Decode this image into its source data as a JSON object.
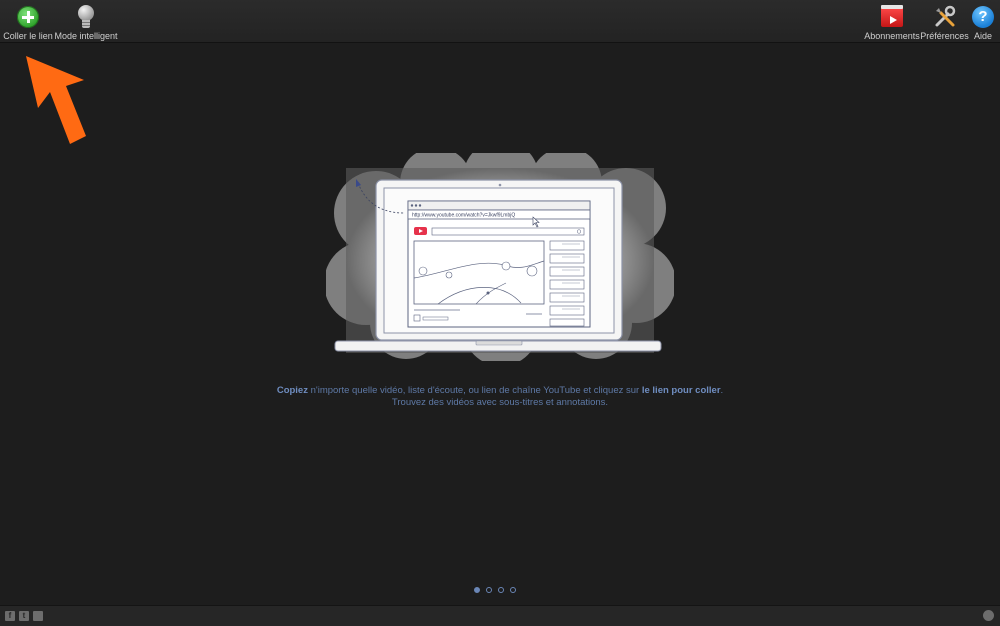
{
  "toolbar": {
    "paste_label": "Coller le lien",
    "smart_label": "Mode intelligent",
    "subs_label": "Abonnements",
    "prefs_label": "Préférences",
    "help_label": "Aide",
    "help_glyph": "?"
  },
  "illustration": {
    "url": "http://www.youtube.com/watch?v=Jkwf9LmbjQ"
  },
  "caption": {
    "line1_bold1": "Copiez",
    "line1_mid": " n'importe quelle vidéo, liste d'écoute, ou lien de chaîne YouTube et cliquez sur ",
    "line1_bold2": "le lien pour coller",
    "line1_end": ".",
    "line2": "Trouvez des vidéos avec sous-titres et annotations."
  },
  "pager": {
    "pages": 4,
    "current": 1
  },
  "footer": {
    "facebook": "f",
    "twitter": "t"
  },
  "colors": {
    "accent_arrow": "#ff6a13",
    "caption": "#5e79a6",
    "background": "#1d1d1d"
  }
}
